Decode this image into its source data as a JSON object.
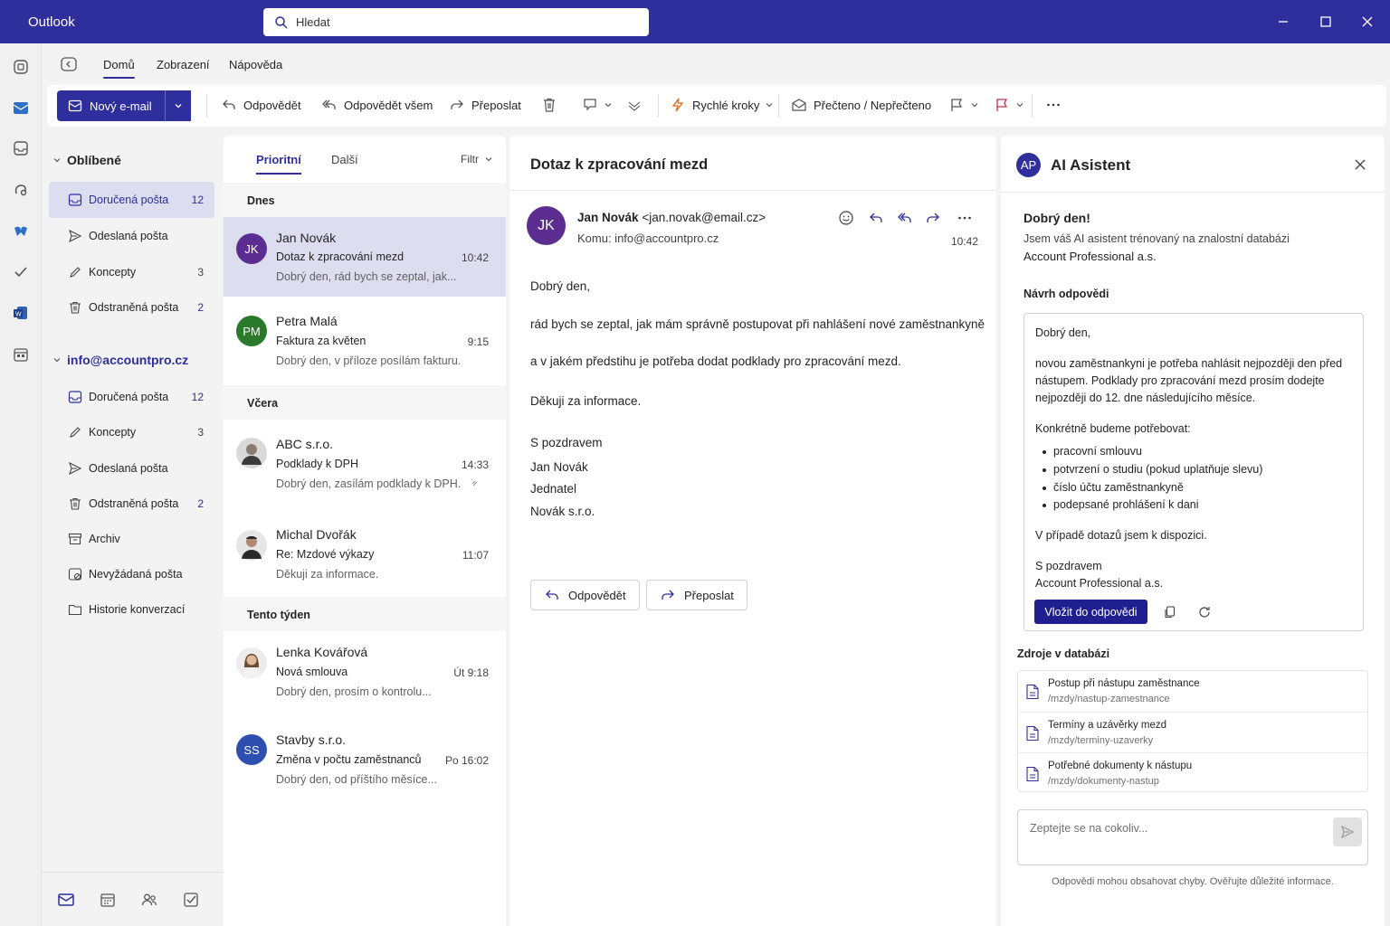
{
  "app": {
    "name": "Outlook"
  },
  "search": {
    "placeholder": "Hledat"
  },
  "ribbon": {
    "tabs": [
      "Domů",
      "Zobrazení",
      "Nápověda"
    ]
  },
  "toolbar": {
    "new_mail": "Nový e-mail",
    "reply": "Odpovědět",
    "reply_all": "Odpovědět všem",
    "forward": "Přeposlat",
    "quick_steps": "Rychlé kroky",
    "read_unread": "Přečteno / Nepřečteno"
  },
  "folders": {
    "favorites": {
      "title": "Oblíbené",
      "items": [
        {
          "label": "Doručená pošta",
          "count": "12"
        },
        {
          "label": "Odeslaná pošta",
          "count": ""
        },
        {
          "label": "Koncepty",
          "count": "3"
        },
        {
          "label": "Odstraněná pošta",
          "count": "2"
        }
      ]
    },
    "account": {
      "title": "info@accountpro.cz",
      "items": [
        {
          "label": "Doručená pošta",
          "count": "12"
        },
        {
          "label": "Koncepty",
          "count": "3"
        },
        {
          "label": "Odeslaná pošta",
          "count": ""
        },
        {
          "label": "Odstraněná pošta",
          "count": "2"
        },
        {
          "label": "Archiv",
          "count": ""
        },
        {
          "label": "Nevyžádaná pošta",
          "count": ""
        },
        {
          "label": "Historie konverzací",
          "count": ""
        }
      ]
    }
  },
  "list": {
    "tabs": {
      "focused": "Prioritní",
      "other": "Další"
    },
    "filter": "Filtr",
    "sections": {
      "today": "Dnes",
      "yesterday": "Včera",
      "this_week": "Tento týden"
    },
    "messages": [
      {
        "from": "Jan Novák",
        "initials": "JK",
        "subject": "Dotaz k zpracování mezd",
        "time": "10:42",
        "preview": "Dobrý den, rád bych se zeptal, jak...",
        "color": "#5c2d91"
      },
      {
        "from": "Petra Malá",
        "initials": "PM",
        "subject": "Faktura za květen",
        "time": "9:15",
        "preview": "Dobrý den, v příloze posílám fakturu...",
        "color": "#2b7a2b"
      },
      {
        "from": "ABC s.r.o.",
        "initials": "",
        "subject": "Podklady k DPH",
        "time": "14:33",
        "preview": "Dobrý den, zasílám podklady k DPH...",
        "color": "#888888"
      },
      {
        "from": "Michal Dvořák",
        "initials": "",
        "subject": "Re: Mzdové výkazy",
        "time": "11:07",
        "preview": "Děkuji za informace.",
        "color": "#555555"
      },
      {
        "from": "Lenka Kovářová",
        "initials": "",
        "subject": "Nová smlouva",
        "time": "Út 9:18",
        "preview": "Dobrý den, prosím o kontrolu...",
        "color": "#b08060"
      },
      {
        "from": "Stavby s.r.o.",
        "initials": "SS",
        "subject": "Změna v počtu zaměstnanců",
        "time": "Po 16:02",
        "preview": "Dobrý den, od příštího měsíce...",
        "color": "#2e4fb0"
      }
    ]
  },
  "reader": {
    "subject": "Dotaz k zpracování mezd",
    "initials": "JK",
    "sender_name": "Jan Novák",
    "sender_email": "<jan.novak@email.cz>",
    "to": "Komu:  info@accountpro.cz",
    "time": "10:42",
    "body": [
      "Dobrý den,",
      "rád bych se zeptal, jak mám správně postupovat při nahlášení nové zaměstnankyně",
      "a v jakém předstihu je potřeba dodat podklady pro zpracování mezd.",
      "Děkuji za informace.",
      "S pozdravem",
      "Jan Novák",
      "Jednatel",
      "Novák s.r.o."
    ],
    "reply_button": "Odpovědět",
    "forward_button": "Přeposlat"
  },
  "ai": {
    "badge": "AP",
    "title": "AI Asistent",
    "greeting": "Dobrý den!",
    "intro_1": "Jsem váš AI asistent trénovaný na znalostní databázi",
    "intro_2": "Account Professional a.s.",
    "draft_label": "Návrh odpovědi",
    "draft": {
      "greeting": "Dobrý den,",
      "p1": "novou zaměstnankyni je potřeba nahlásit nejpozději den před nástupem. Podklady pro zpracování mezd prosím dodejte nejpozději do 12. dne následujícího měsíce.",
      "p2": "Konkrétně budeme potřebovat:",
      "bullets": [
        "pracovní smlouvu",
        "potvrzení o studiu (pokud uplatňuje slevu)",
        "číslo účtu zaměstnankyně",
        "podepsané prohlášení k dani"
      ],
      "p3": "V případě dotazů jsem k dispozici.",
      "closing_1": "S pozdravem",
      "closing_2": "Account Professional a.s."
    },
    "insert_button": "Vložit do odpovědi",
    "sources_label": "Zdroje v databázi",
    "sources": [
      {
        "title": "Postup při nástupu zaměstnance",
        "path": "/mzdy/nastup-zamestnance"
      },
      {
        "title": "Termíny a uzávěrky mezd",
        "path": "/mzdy/terminy-uzaverky"
      },
      {
        "title": "Potřebné dokumenty k nástupu",
        "path": "/mzdy/dokumenty-nastup"
      }
    ],
    "ask_placeholder": "Zeptejte se na cokoliv...",
    "disclaimer": "Odpovědi mohou obsahovat chyby. Ověřujte důležité informace."
  },
  "colors": {
    "brand": "#2e2e9c",
    "selected": "#dcdef0"
  }
}
